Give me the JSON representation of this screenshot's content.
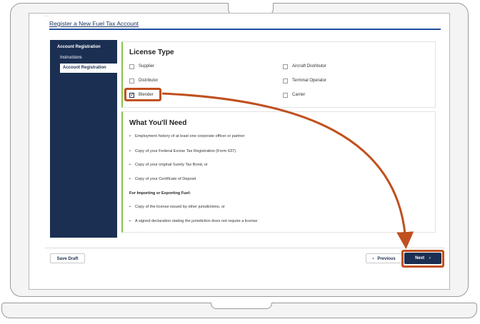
{
  "header": {
    "dots": "..",
    "title": "Register a New Fuel Tax Account"
  },
  "sidebar": {
    "heading": "Account Registration",
    "items": [
      {
        "label": "Instructions"
      },
      {
        "label": "Account Registration",
        "active": true
      }
    ]
  },
  "license": {
    "title": "License Type",
    "options": [
      {
        "label": "Supplier",
        "checked": false
      },
      {
        "label": "Distributor",
        "checked": false
      },
      {
        "label": "Blender",
        "checked": true
      },
      {
        "label": "Aircraft Distributor",
        "checked": false
      },
      {
        "label": "Terminal Operator",
        "checked": false
      },
      {
        "label": "Carrier",
        "checked": false
      }
    ]
  },
  "need": {
    "title": "What You'll Need",
    "items": [
      "Employment history of at least one corporate officer or partner",
      "Copy of your Federal Excise Tax Registration (Form 637)",
      "Copy of your original Surety Tax Bond, or",
      "Copy of your Certificate of Deposit"
    ],
    "subheading": "For Importing or Exporting Fuel:",
    "items2": [
      "Copy of the license issued by other jurisdictions, or",
      "A signed declaration stating the jurisdiction does not require a license"
    ]
  },
  "footer": {
    "save_label": "Save Draft",
    "previous_label": "Previous",
    "next_label": "Next"
  },
  "colors": {
    "nav": "#1b2f52",
    "accent": "#8bc34a",
    "annotation": "#c0501f"
  }
}
